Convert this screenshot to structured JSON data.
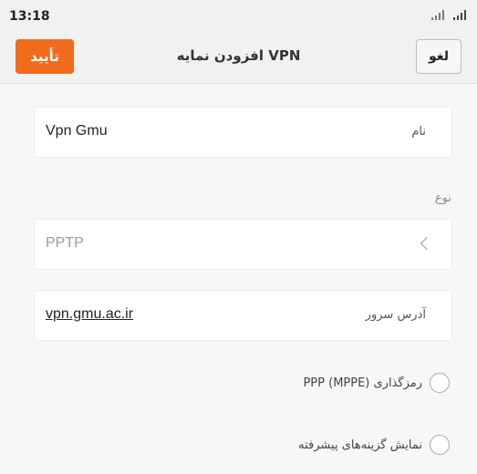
{
  "status_bar": {
    "time": "13:18",
    "icons": [
      "signal-icon",
      "signal-icon"
    ]
  },
  "header": {
    "confirm_label": "تأیید",
    "title": "افزودن نمایه VPN",
    "cancel_label": "لغو",
    "confirm_color": "#f26a1b"
  },
  "form": {
    "name": {
      "label": "نام",
      "value": "Vpn Gmu"
    },
    "type": {
      "section_label": "نوع",
      "value": "PPTP",
      "icon": "chevron-left-icon"
    },
    "server": {
      "label": "آدرس سرور",
      "value": "vpn.gmu.ac.ir"
    },
    "options": [
      {
        "label": "رمزگذاری PPP (MPPE)",
        "checked": false
      },
      {
        "label": "نمایش گزینه‌های پیشرفته",
        "checked": false
      }
    ]
  }
}
